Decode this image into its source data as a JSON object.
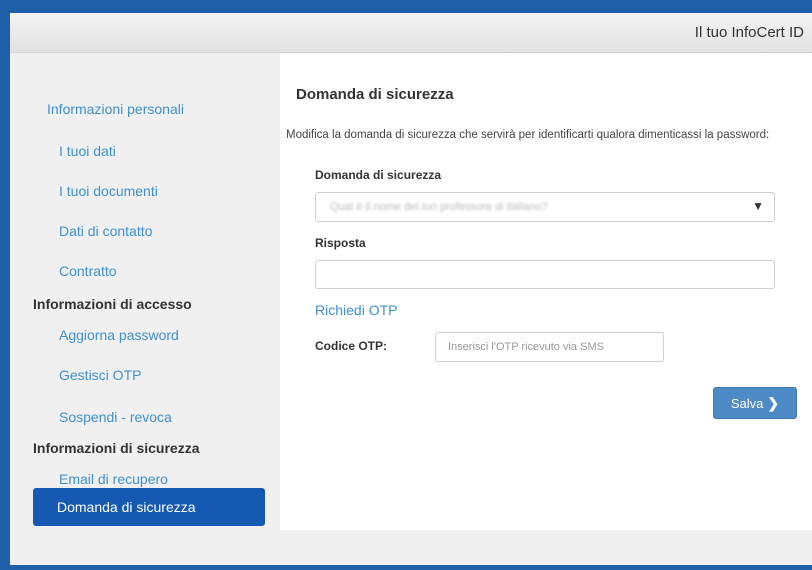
{
  "header": {
    "brand": "Il tuo InfoCert ID"
  },
  "sidebar": {
    "personal_section": "Informazioni personali",
    "personal_items": [
      "I tuoi dati",
      "I tuoi documenti",
      "Dati di contatto",
      "Contratto"
    ],
    "access_section": "Informazioni di accesso",
    "access_items": [
      "Aggiorna password",
      "Gestisci OTP",
      "Sospendi - revoca"
    ],
    "security_section": "Informazioni di sicurezza",
    "security_items": [
      "Email di recupero",
      "Domanda di sicurezza"
    ]
  },
  "main": {
    "title": "Domanda di sicurezza",
    "description": "Modifica la domanda di sicurezza che servirà per identificarti qualora dimenticassi la password:",
    "question_label": "Domanda di sicurezza",
    "question_value": "Qual è il nome del tuo professore di italiano?",
    "answer_label": "Risposta",
    "answer_value": "",
    "request_otp_link": "Richiedi OTP",
    "otp_label": "Codice OTP:",
    "otp_placeholder": "Inserisci l'OTP ricevuto via SMS",
    "save_label": "Salva",
    "save_icon": "chevron-right-icon"
  },
  "colors": {
    "accent": "#1559b3",
    "link": "#3f8fd1",
    "button": "#4e8bc6",
    "border": "#1f5fa9"
  }
}
